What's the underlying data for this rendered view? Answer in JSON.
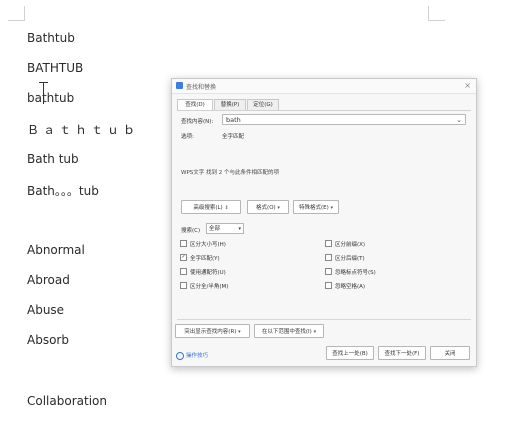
{
  "document": {
    "lines": [
      "Bathtub",
      "BATHTUB",
      "bathtub",
      "Ｂａｔｈｔｕｂ",
      "Bath tub",
      "Bath。。。tub",
      "Abnormal",
      "Abroad",
      "Abuse",
      "Absorb",
      "Collaboration"
    ]
  },
  "dialog": {
    "title": "查找和替换",
    "close": "×",
    "tabs": [
      "查找(D)",
      "替换(P)",
      "定位(G)"
    ],
    "find_label": "查找内容(N):",
    "find_value": "bath",
    "options_label": "选项:",
    "options_value": "全字匹配",
    "status": "WPS文字 找到 2 个与此条件相匹配的项",
    "more_button": "高级搜索(L)",
    "format_button": "格式(O)",
    "special_button": "特殊格式(E)",
    "search_label": "搜索(C)",
    "search_value": "全部",
    "checkboxes_left": [
      {
        "label": "区分大小写(H)",
        "checked": false
      },
      {
        "label": "全字匹配(Y)",
        "checked": true
      },
      {
        "label": "使用通配符(U)",
        "checked": false
      },
      {
        "label": "区分全/半角(M)",
        "checked": false
      }
    ],
    "checkboxes_right": [
      {
        "label": "区分前缀(X)",
        "checked": false
      },
      {
        "label": "区分后缀(T)",
        "checked": false
      },
      {
        "label": "忽略标点符号(S)",
        "checked": false
      },
      {
        "label": "忽略空格(A)",
        "checked": false
      }
    ],
    "highlight_button": "突出显示查找内容(R)",
    "find_in_button": "在以下范围中查找(I)",
    "tips_link": "操作技巧",
    "prev_button": "查找上一处(B)",
    "next_button": "查找下一处(F)",
    "close_button": "关闭"
  }
}
